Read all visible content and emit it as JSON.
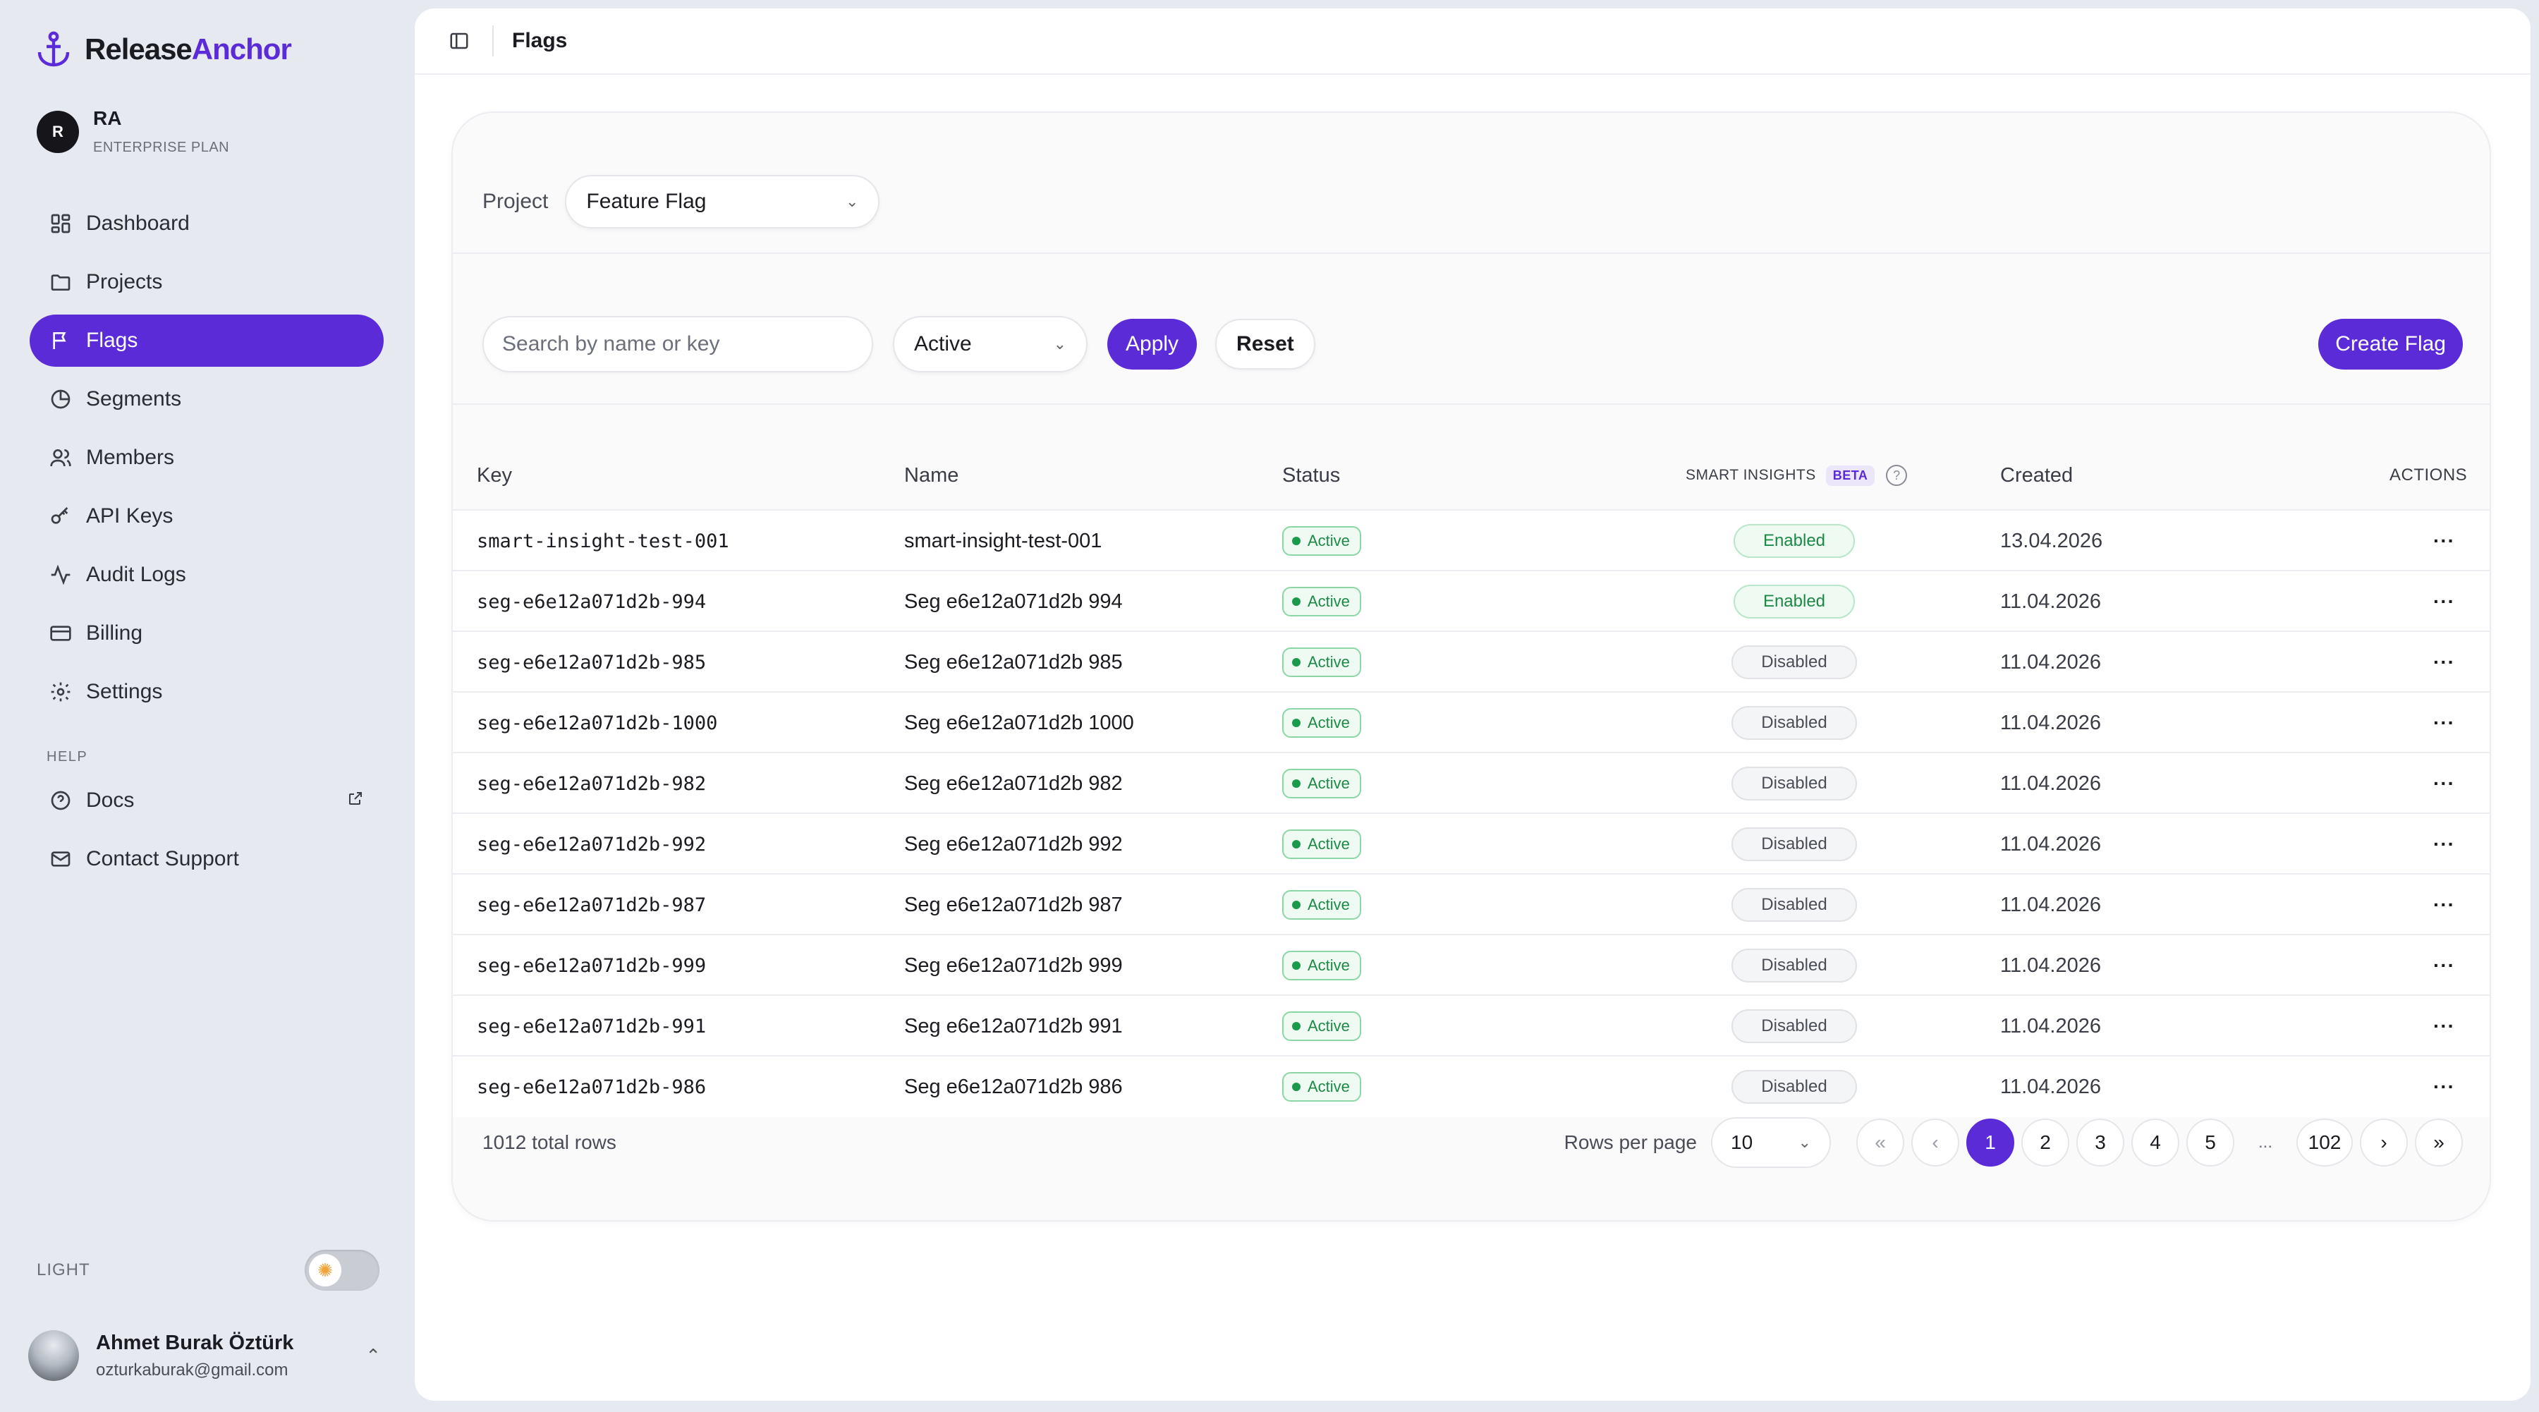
{
  "brand": {
    "part1": "Release",
    "part2": "Anchor"
  },
  "org": {
    "initial": "R",
    "name": "RA",
    "plan": "ENTERPRISE PLAN"
  },
  "nav": {
    "items": [
      {
        "label": "Dashboard",
        "icon": "grid-icon"
      },
      {
        "label": "Projects",
        "icon": "folder-icon"
      },
      {
        "label": "Flags",
        "icon": "flag-icon",
        "active": true
      },
      {
        "label": "Segments",
        "icon": "pie-icon"
      },
      {
        "label": "Members",
        "icon": "users-icon"
      },
      {
        "label": "API Keys",
        "icon": "key-icon"
      },
      {
        "label": "Audit Logs",
        "icon": "activity-icon"
      },
      {
        "label": "Billing",
        "icon": "card-icon"
      },
      {
        "label": "Settings",
        "icon": "gear-icon"
      }
    ],
    "help_label": "HELP",
    "help_items": [
      {
        "label": "Docs",
        "icon": "help-circle-icon"
      },
      {
        "label": "Contact Support",
        "icon": "mail-icon"
      }
    ]
  },
  "theme": {
    "label": "LIGHT",
    "icon": "sun-icon"
  },
  "user": {
    "name": "Ahmet Burak Öztürk",
    "email": "ozturkaburak@gmail.com"
  },
  "breadcrumb": "Flags",
  "project": {
    "label": "Project",
    "value": "Feature Flag"
  },
  "filters": {
    "search_placeholder": "Search by name or key",
    "status_value": "Active",
    "apply": "Apply",
    "reset": "Reset",
    "create": "Create Flag"
  },
  "table": {
    "headers": {
      "key": "Key",
      "name": "Name",
      "status": "Status",
      "insights": "SMART INSIGHTS",
      "beta": "BETA",
      "help": "?",
      "created": "Created",
      "actions": "ACTIONS"
    },
    "rows": [
      {
        "key": "smart-insight-test-001",
        "name": "smart-insight-test-001",
        "status": "Active",
        "insight": "Enabled",
        "created": "13.04.2026"
      },
      {
        "key": "seg-e6e12a071d2b-994",
        "name": "Seg e6e12a071d2b 994",
        "status": "Active",
        "insight": "Enabled",
        "created": "11.04.2026"
      },
      {
        "key": "seg-e6e12a071d2b-985",
        "name": "Seg e6e12a071d2b 985",
        "status": "Active",
        "insight": "Disabled",
        "created": "11.04.2026"
      },
      {
        "key": "seg-e6e12a071d2b-1000",
        "name": "Seg e6e12a071d2b 1000",
        "status": "Active",
        "insight": "Disabled",
        "created": "11.04.2026"
      },
      {
        "key": "seg-e6e12a071d2b-982",
        "name": "Seg e6e12a071d2b 982",
        "status": "Active",
        "insight": "Disabled",
        "created": "11.04.2026"
      },
      {
        "key": "seg-e6e12a071d2b-992",
        "name": "Seg e6e12a071d2b 992",
        "status": "Active",
        "insight": "Disabled",
        "created": "11.04.2026"
      },
      {
        "key": "seg-e6e12a071d2b-987",
        "name": "Seg e6e12a071d2b 987",
        "status": "Active",
        "insight": "Disabled",
        "created": "11.04.2026"
      },
      {
        "key": "seg-e6e12a071d2b-999",
        "name": "Seg e6e12a071d2b 999",
        "status": "Active",
        "insight": "Disabled",
        "created": "11.04.2026"
      },
      {
        "key": "seg-e6e12a071d2b-991",
        "name": "Seg e6e12a071d2b 991",
        "status": "Active",
        "insight": "Disabled",
        "created": "11.04.2026"
      },
      {
        "key": "seg-e6e12a071d2b-986",
        "name": "Seg e6e12a071d2b 986",
        "status": "Active",
        "insight": "Disabled",
        "created": "11.04.2026"
      }
    ]
  },
  "pagination": {
    "total": "1012 total rows",
    "rows_per_page_label": "Rows per page",
    "rows_per_page": "10",
    "first": "«",
    "prev": "‹",
    "next": "›",
    "last": "»",
    "pages": [
      "1",
      "2",
      "3",
      "4",
      "5"
    ],
    "ellipsis": "...",
    "last_page": "102",
    "current": "1"
  },
  "colors": {
    "accent": "#5b2bd8",
    "active_green": "#1c8a45"
  }
}
